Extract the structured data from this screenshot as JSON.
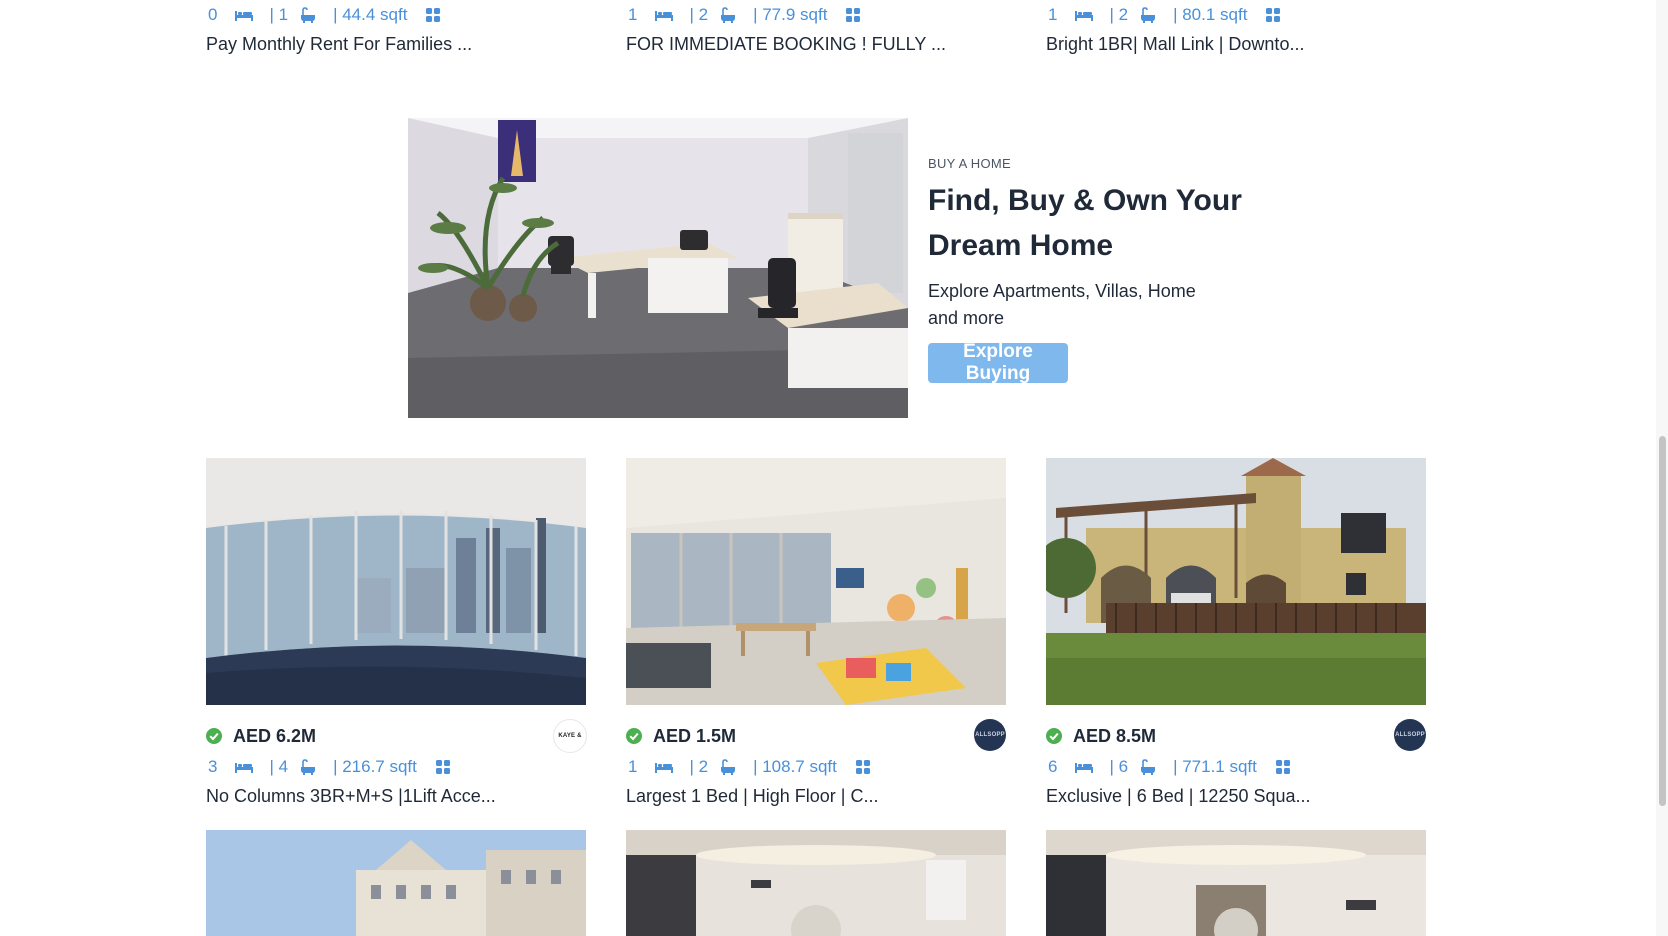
{
  "top_listings": [
    {
      "beds": "0",
      "baths": "| 1",
      "area": "| 44.4 sqft",
      "title": "Pay Monthly Rent For Families ..."
    },
    {
      "beds": "1",
      "baths": "| 2",
      "area": "| 77.9 sqft",
      "title": "FOR IMMEDIATE BOOKING ! FULLY ..."
    },
    {
      "beds": "1",
      "baths": "| 2",
      "area": "| 80.1 sqft",
      "title": "Bright 1BR| Mall Link | Downto..."
    }
  ],
  "banner": {
    "eyebrow": "BUY A HOME",
    "title": "Find, Buy & Own Your Dream Home",
    "description": "Explore Apartments, Villas, Home and more",
    "button_label": "Explore Buying"
  },
  "listings": [
    {
      "price": "AED 6.2M",
      "beds": "3",
      "baths": "| 4",
      "area": "| 216.7 sqft",
      "title": "No Columns 3BR+M+S |1Lift Acce...",
      "agency_logo_text": "KAYE &"
    },
    {
      "price": "AED 1.5M",
      "beds": "1",
      "baths": "| 2",
      "area": "| 108.7 sqft",
      "title": "Largest 1 Bed | High Floor | C...",
      "agency_logo_text": "ALLSOPP"
    },
    {
      "price": "AED 8.5M",
      "beds": "6",
      "baths": "| 6",
      "area": "| 771.1 sqft",
      "title": "Exclusive | 6 Bed | 12250 Squa...",
      "agency_logo_text": "ALLSOPP"
    }
  ],
  "icons": {
    "bed": "bed-icon",
    "bath": "bath-icon",
    "layout": "floorplan-icon",
    "verified": "verified-check-icon"
  },
  "colors": {
    "accent_blue": "#4a90d9",
    "button_blue": "#7fb8ec",
    "verified_green": "#4caf50",
    "text_dark": "#1f2937"
  }
}
